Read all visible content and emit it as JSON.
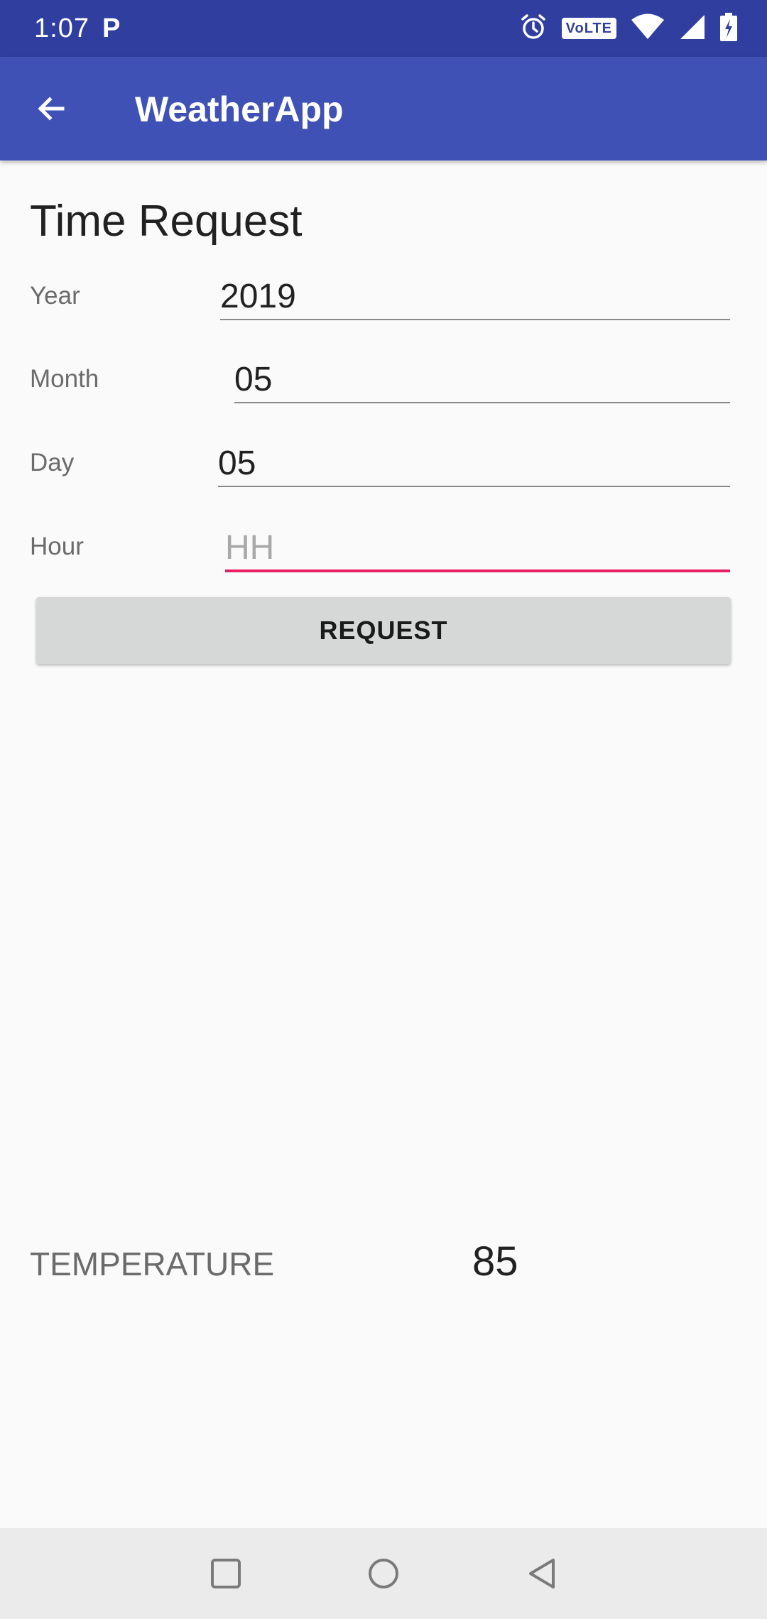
{
  "status_bar": {
    "time": "1:07",
    "notification_letter": "P",
    "volte_label": "VoLTE",
    "icons": [
      "alarm-icon",
      "volte-icon",
      "wifi-icon",
      "signal-icon",
      "battery-icon"
    ]
  },
  "app_bar": {
    "title": "WeatherApp",
    "back_icon": "arrow-back-icon"
  },
  "form": {
    "title": "Time Request",
    "fields": [
      {
        "label": "Year",
        "value": "2019",
        "placeholder": ""
      },
      {
        "label": "Month",
        "value": "05",
        "placeholder": ""
      },
      {
        "label": "Day",
        "value": "05",
        "placeholder": ""
      },
      {
        "label": "Hour",
        "value": "",
        "placeholder": "HH"
      }
    ],
    "request_button": "REQUEST"
  },
  "result": {
    "label": "TEMPERATURE",
    "value": "85"
  },
  "colors": {
    "status_bar": "#303f9f",
    "app_bar": "#3f51b5",
    "focus_accent": "#e91e63",
    "background": "#fafafa"
  },
  "nav_bar": {
    "icons": [
      "recents-square-icon",
      "home-circle-icon",
      "back-triangle-icon"
    ]
  }
}
